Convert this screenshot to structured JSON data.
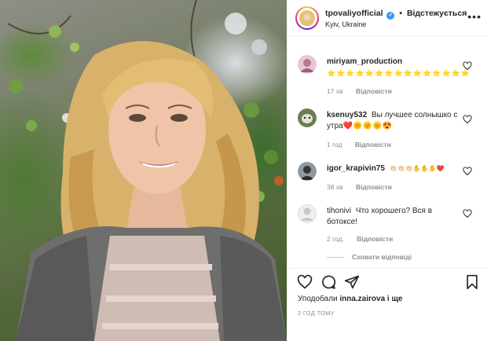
{
  "header": {
    "username": "tpovaliyofficial",
    "verified_icon": "verified-badge-icon",
    "separator": "•",
    "follow_label": "Відстежується",
    "location": "Kyiv, Ukraine",
    "more_icon": "more-options-icon"
  },
  "comments": [
    {
      "username": "miriyam_production",
      "text": "⭐⭐⭐⭐⭐⭐⭐⭐⭐⭐⭐⭐⭐⭐⭐",
      "time": "17 хв",
      "reply_label": "Відповісти",
      "avatar": "pink-avatar"
    },
    {
      "username": "ksenuy532",
      "text": "Вы лучшее солнышко с утра❤️🌞🌞🌞😍",
      "time": "1 год",
      "reply_label": "Відповісти",
      "avatar": "dog-avatar"
    },
    {
      "username": "igor_krapivin75",
      "text": "👏🏻👏🏻👏🏻✋✋✋❤️",
      "time": "38 хв",
      "reply_label": "Відповісти",
      "avatar": "man-avatar"
    },
    {
      "username": "tihonivi",
      "text": "Что хорошего? Вся в ботоксе!",
      "time": "2 год.",
      "reply_label": "Відповісти",
      "avatar": "default-avatar"
    }
  ],
  "hide_replies_label": "Сховати відповіді",
  "actions": {
    "like_icon": "heart-icon",
    "comment_icon": "comment-icon",
    "share_icon": "send-icon",
    "save_icon": "bookmark-icon"
  },
  "likes": {
    "prefix": "Уподобали",
    "user": "inna.zairova",
    "suffix": "і ще"
  },
  "posted_ago": "2 ГОД ТОМУ",
  "colors": {
    "verified": "#3897f0",
    "muted_text": "#8e8e8e",
    "primary_text": "#262626",
    "divider": "#efefef"
  }
}
